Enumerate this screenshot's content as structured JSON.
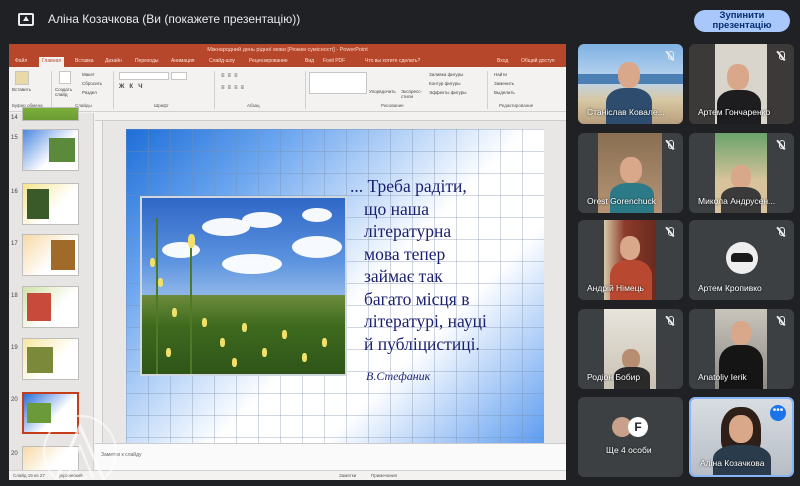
{
  "header": {
    "presenting_title": "Аліна Козачкова (Ви (покажете презентацію))",
    "stop_button": "Зупинити презентацію"
  },
  "ppt": {
    "window_title": "Міжнародний день рідної мови [Режим сумісності] - PowerPoint",
    "tabs": [
      "Файл",
      "Главная",
      "Вставка",
      "Дизайн",
      "Переходы",
      "Анимация",
      "Слайд-шоу",
      "Рецензирование",
      "Вид",
      "Foxit PDF",
      "Что вы хотите сделать?",
      "Вход",
      "Общий доступ"
    ],
    "ribbon": {
      "paste": "Вставить",
      "create_slide": "Создать слайд",
      "layout": "Макет",
      "reset": "Сбросить",
      "section": "Раздел",
      "groups": [
        "Буфер обмена",
        "Слайды",
        "Шрифт",
        "Абзац",
        "Рисование",
        "Редактирование"
      ],
      "arrange": "Упорядочить",
      "quick_styles": "Экспресс-стили",
      "shape_fill": "Заливка фигуры",
      "shape_outline": "Контур фигуры",
      "shape_effects": "Эффекты фигуры",
      "find": "Найти",
      "replace": "Заменить",
      "select": "Выделить"
    },
    "thumb_numbers": [
      "14",
      "15",
      "16",
      "17",
      "18",
      "19",
      "20"
    ],
    "slide": {
      "text_lines": [
        "... Треба радіти,",
        "що наша",
        "літературна",
        "мова тепер",
        "займає так",
        "багато місця в",
        "літературі, науці",
        "й публіцистиці."
      ],
      "author": "В.Стефаник"
    },
    "notes_placeholder": "Заметки к слайду",
    "status": {
      "slide_info": "Слайд 19 из 27",
      "language": "украинский",
      "notes": "Заметки",
      "comments": "Примечания"
    }
  },
  "participants": [
    {
      "name": "Станіслав Ковале...",
      "muted": true
    },
    {
      "name": "Артем Гончаренко",
      "muted": true
    },
    {
      "name": "Orest Gorenchuck",
      "muted": true
    },
    {
      "name": "Микола Андрусен...",
      "muted": true
    },
    {
      "name": "Андрій Німець",
      "muted": true
    },
    {
      "name": "Артем Кропивко",
      "muted": true
    },
    {
      "name": "Родіон Бобир",
      "muted": true
    },
    {
      "name": "Anatoliy Ierik",
      "muted": true
    },
    {
      "name": "Ще 4 особи",
      "muted": false
    },
    {
      "name": "Аліна Козачкова",
      "muted": false
    }
  ],
  "colors": {
    "background": "#202124",
    "tile": "#3c4043",
    "accent": "#a8c7fa",
    "ppt_red": "#b7472a"
  }
}
